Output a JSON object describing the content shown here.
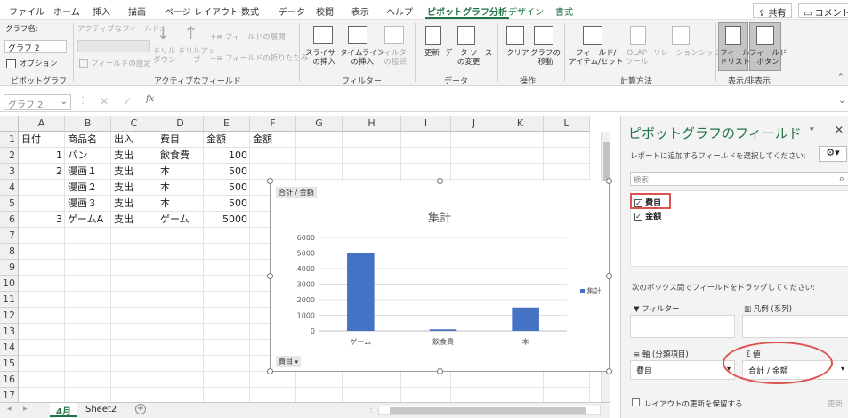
{
  "tabs": [
    "ファイル",
    "ホーム",
    "挿入",
    "描画",
    "ページ レイアウト",
    "数式",
    "データ",
    "校閲",
    "表示",
    "ヘルプ",
    "ピボットグラフ分析",
    "デザイン",
    "書式"
  ],
  "top_buttons": {
    "share": "共有",
    "comment": "コメント"
  },
  "ribbon": {
    "chart_name_label": "グラフ名:",
    "chart_name_value": "グラフ 2",
    "options_label": "オプション",
    "group_pivotchart": "ピボットグラフ",
    "active_field_label": "アクティブなフィールド:",
    "field_settings": "フィールドの設定",
    "drilldown": "ドリル\nダウン",
    "drillup": "ドリルアッ\nプ",
    "expand_field": "フィールドの展開",
    "collapse_field": "フィールドの折りたたみ",
    "group_activefield": "アクティブなフィールド",
    "slicer": "スライサー\nの挿入",
    "timeline": "タイムライン\nの挿入",
    "filter_conn": "フィルター\nの接続",
    "group_filter": "フィルター",
    "refresh": "更新",
    "change_source": "データ ソース\nの変更",
    "group_data": "データ",
    "clear": "クリア",
    "move_chart": "グラフの\n移動",
    "group_actions": "操作",
    "fields_items": "フィールド/\nアイテム/セット",
    "olap_tools": "OLAP\nツール",
    "relationships": "リレーションシップ",
    "group_calc": "計算方法",
    "field_list": "フィール\nドリスト",
    "field_buttons": "フィールド\nボタン",
    "group_showhide": "表示/非表示"
  },
  "formula_bar": {
    "name_box": "グラフ 2",
    "fx": "fx"
  },
  "columns": [
    "A",
    "B",
    "C",
    "D",
    "E",
    "F",
    "G",
    "H",
    "I",
    "J",
    "K",
    "L"
  ],
  "rows": [
    "1",
    "2",
    "3",
    "4",
    "5",
    "6",
    "7",
    "8",
    "9",
    "10",
    "11",
    "12",
    "13",
    "14",
    "15",
    "16",
    "17"
  ],
  "cells": {
    "r1": [
      "日付",
      "商品名",
      "出入",
      "費目",
      "金額",
      "金額"
    ],
    "r2": [
      "1",
      "パン",
      "支出",
      "飲食費",
      "100"
    ],
    "r3": [
      "2",
      "漫画１",
      "支出",
      "本",
      "500"
    ],
    "r4": [
      "",
      "漫画２",
      "支出",
      "本",
      "500"
    ],
    "r5": [
      "",
      "漫画３",
      "支出",
      "本",
      "500"
    ],
    "r6": [
      "3",
      "ゲームA",
      "支出",
      "ゲーム",
      "5000"
    ]
  },
  "chart_data": {
    "type": "bar",
    "title": "集計",
    "categories": [
      "ゲーム",
      "飲食費",
      "本"
    ],
    "series": [
      {
        "name": "集計",
        "values": [
          5000,
          100,
          1500
        ]
      }
    ],
    "yticks": [
      "0",
      "1000",
      "2000",
      "3000",
      "4000",
      "5000",
      "6000"
    ],
    "ylim": [
      0,
      6000
    ],
    "grid": true,
    "legend": "right",
    "value_button": "合計 / 金額",
    "axis_button": "費目",
    "bar_color": "#4472c4"
  },
  "panel": {
    "title": "ピボットグラフのフィールド",
    "subtitle": "レポートに追加するフィールドを選択してください:",
    "search_placeholder": "検索",
    "fields": [
      {
        "label": "費目",
        "checked": true
      },
      {
        "label": "金額",
        "checked": true
      }
    ],
    "drag_hint": "次のボックス間でフィールドをドラッグしてください:",
    "filters_label": "フィルター",
    "legend_label": "凡例 (系列)",
    "axis_label": "軸 (分類項目)",
    "values_label": "値",
    "axis_item": "費目",
    "values_item": "合計 / 金額",
    "defer_label": "レイアウトの更新を保留する",
    "update_button": "更新",
    "accent": "#217346",
    "highlight": "#d9534f"
  },
  "sheet_tabs": [
    "4月",
    "Sheet2"
  ]
}
